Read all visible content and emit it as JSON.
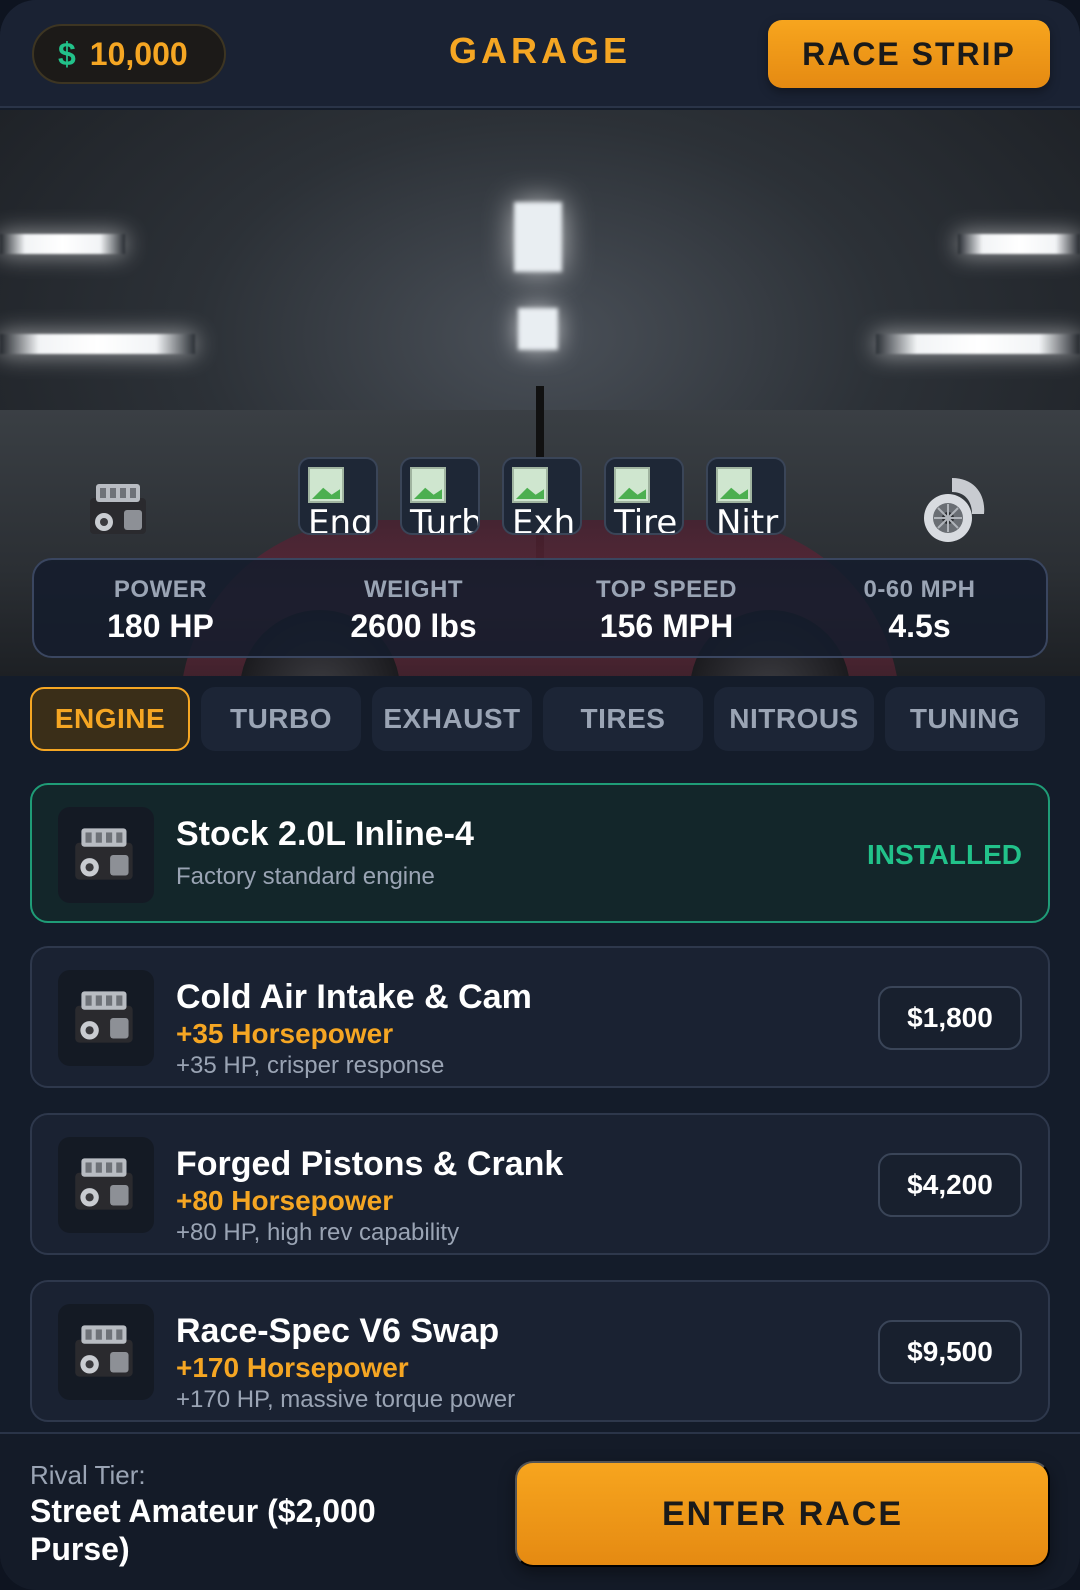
{
  "header": {
    "cash_symbol": "$",
    "cash_amount": "10,000",
    "title": "GARAGE",
    "race_strip_label": "RACE STRIP"
  },
  "hero": {
    "left_icon": "engine-icon",
    "right_icon": "turbo-icon",
    "slots": [
      {
        "label": "Eng",
        "icon": "broken-image-icon"
      },
      {
        "label": "Turb",
        "icon": "broken-image-icon"
      },
      {
        "label": "Exh",
        "icon": "broken-image-icon"
      },
      {
        "label": "Tire",
        "icon": "broken-image-icon"
      },
      {
        "label": "Nitr",
        "icon": "broken-image-icon"
      }
    ]
  },
  "stats": [
    {
      "label": "POWER",
      "value": "180 HP"
    },
    {
      "label": "WEIGHT",
      "value": "2600 lbs"
    },
    {
      "label": "TOP SPEED",
      "value": "156 MPH"
    },
    {
      "label": "0-60 MPH",
      "value": "4.5s"
    }
  ],
  "tabs": [
    {
      "label": "ENGINE",
      "active": true
    },
    {
      "label": "TURBO",
      "active": false
    },
    {
      "label": "EXHAUST",
      "active": false
    },
    {
      "label": "TIRES",
      "active": false
    },
    {
      "label": "NITROUS",
      "active": false
    },
    {
      "label": "TUNING",
      "active": false
    }
  ],
  "parts": [
    {
      "name": "Stock 2.0L Inline-4",
      "subtitle": "Factory standard engine",
      "status": "INSTALLED"
    },
    {
      "name": "Cold Air Intake & Cam",
      "bonus": "+35 Horsepower",
      "description": "+35 HP, crisper response",
      "price": "$1,800"
    },
    {
      "name": "Forged Pistons & Crank",
      "bonus": "+80 Horsepower",
      "description": "+80 HP, high rev capability",
      "price": "$4,200"
    },
    {
      "name": "Race-Spec V6 Swap",
      "bonus": "+170 Horsepower",
      "description": "+170 HP, massive torque power",
      "price": "$9,500"
    }
  ],
  "footer": {
    "rival_label": "Rival Tier:",
    "rival_value": "Street Amateur ($2,000 Purse)",
    "enter_label": "ENTER RACE"
  },
  "colors": {
    "accent": "#f5a623",
    "installed": "#22c28a",
    "background": "#141c2a"
  }
}
